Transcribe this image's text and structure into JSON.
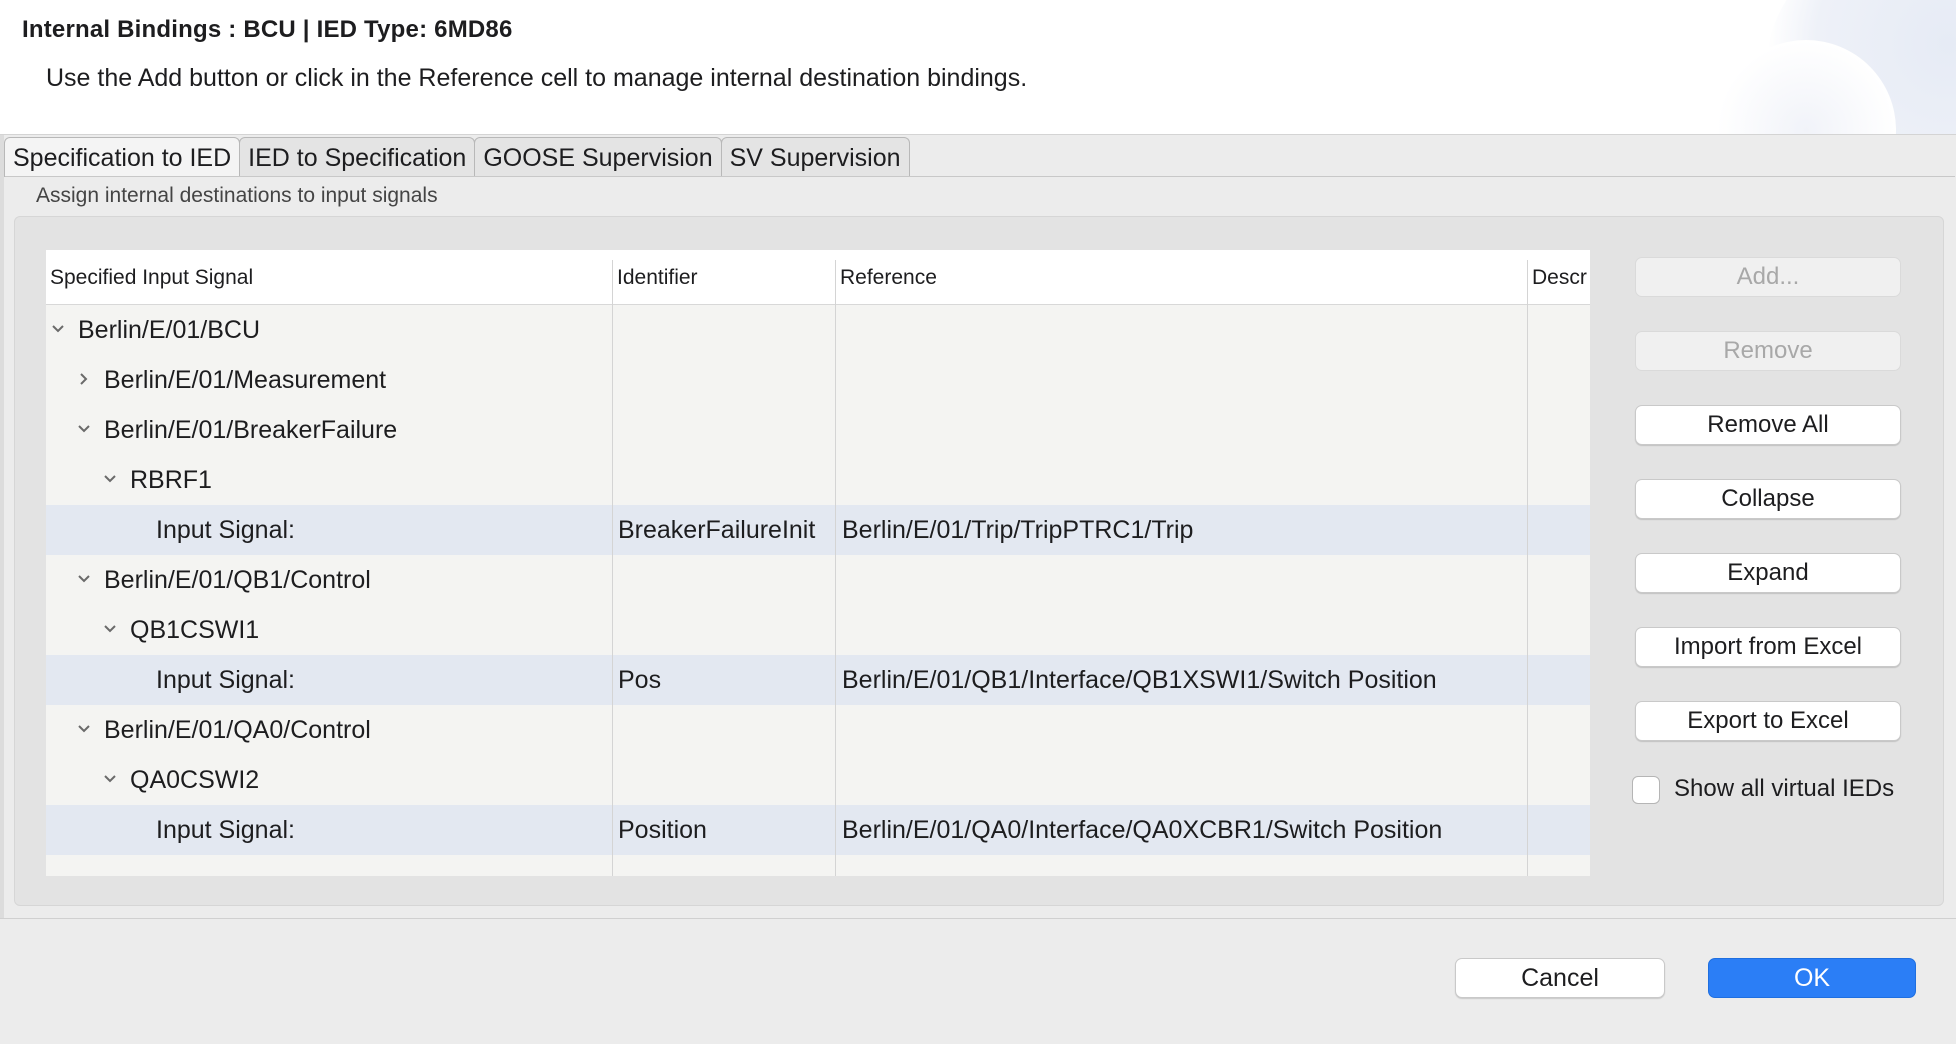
{
  "dialog": {
    "title": "Internal Bindings : BCU  |  IED Type: 6MD86",
    "subtitle": "Use the Add button or click in the Reference cell to manage internal destination bindings."
  },
  "tabs": [
    {
      "label": "Specification to IED",
      "active": true
    },
    {
      "label": "IED to Specification",
      "active": false
    },
    {
      "label": "GOOSE Supervision",
      "active": false
    },
    {
      "label": "SV Supervision",
      "active": false
    }
  ],
  "panel": {
    "caption": "Assign internal destinations to input signals"
  },
  "table": {
    "columns": [
      "Specified Input Signal",
      "Identifier",
      "Reference",
      "Descr"
    ],
    "rows": [
      {
        "level": 0,
        "expander": "expanded",
        "signal": "Berlin/E/01/BCU",
        "identifier": "",
        "reference": ""
      },
      {
        "level": 1,
        "expander": "collapsed",
        "signal": "Berlin/E/01/Measurement",
        "identifier": "",
        "reference": ""
      },
      {
        "level": 1,
        "expander": "expanded",
        "signal": "Berlin/E/01/BreakerFailure",
        "identifier": "",
        "reference": ""
      },
      {
        "level": 2,
        "expander": "expanded",
        "signal": "RBRF1",
        "identifier": "",
        "reference": ""
      },
      {
        "level": 3,
        "expander": "none",
        "signal": "Input Signal:",
        "identifier": "BreakerFailureInit",
        "reference": "Berlin/E/01/Trip/TripPTRC1/Trip"
      },
      {
        "level": 1,
        "expander": "expanded",
        "signal": "Berlin/E/01/QB1/Control",
        "identifier": "",
        "reference": ""
      },
      {
        "level": 2,
        "expander": "expanded",
        "signal": "QB1CSWI1",
        "identifier": "",
        "reference": ""
      },
      {
        "level": 3,
        "expander": "none",
        "signal": "Input Signal:",
        "identifier": "Pos",
        "reference": "Berlin/E/01/QB1/Interface/QB1XSWI1/Switch Position"
      },
      {
        "level": 1,
        "expander": "expanded",
        "signal": "Berlin/E/01/QA0/Control",
        "identifier": "",
        "reference": ""
      },
      {
        "level": 2,
        "expander": "expanded",
        "signal": "QA0CSWI2",
        "identifier": "",
        "reference": ""
      },
      {
        "level": 3,
        "expander": "none",
        "signal": "Input Signal:",
        "identifier": "Position",
        "reference": "Berlin/E/01/QA0/Interface/QA0XCBR1/Switch Position"
      }
    ]
  },
  "side_buttons": {
    "add": "Add...",
    "remove": "Remove",
    "remove_all": "Remove All",
    "collapse": "Collapse",
    "expand": "Expand",
    "import_excel": "Import from Excel",
    "export_excel": "Export to Excel"
  },
  "show_virtual": {
    "label": "Show all virtual IEDs",
    "checked": false
  },
  "footer": {
    "cancel": "Cancel",
    "ok": "OK"
  },
  "colors": {
    "accent": "#2b7ef6",
    "selected_row": "#e3e8f1"
  }
}
